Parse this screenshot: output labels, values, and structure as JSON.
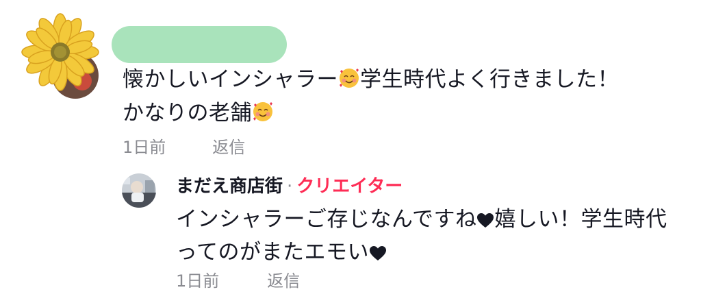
{
  "colors": {
    "redacted_name_bg": "#a9e3bb",
    "creator_badge": "#fe2c55",
    "meta_text": "#8a8b91",
    "main_text": "#161823",
    "heart": "#161823"
  },
  "comment": {
    "avatar_icon": "sunflower-avatar",
    "text_part1": "懐かしいインシャラー",
    "emoji_1": "smiling-face-with-hearts",
    "text_part2": "学生時代よく行きました！",
    "text_part3": "かなりの老舗",
    "emoji_2": "smiling-face-with-hearts",
    "time": "1日前",
    "reply_label": "返信"
  },
  "reply": {
    "author": "まだえ商店街",
    "separator": "·",
    "badge": "クリエイター",
    "text_part1": "インシャラーご存じなんですね",
    "heart_1": "heart-icon",
    "text_part2": "嬉しい！学生時代ってのがまたエモい",
    "heart_2": "heart-icon",
    "time": "1日前",
    "reply_label": "返信"
  }
}
